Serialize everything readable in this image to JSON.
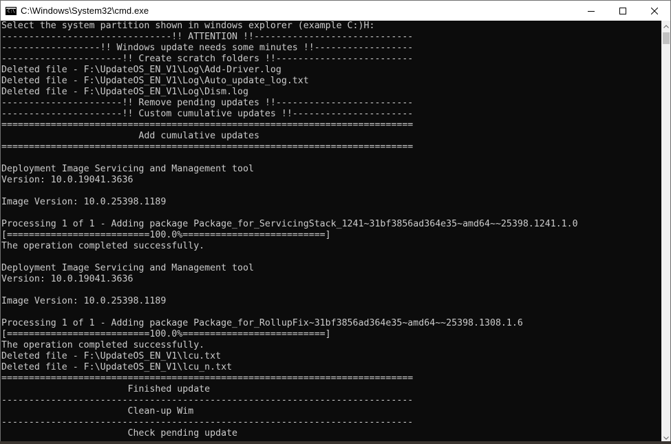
{
  "window": {
    "title": "C:\\Windows\\System32\\cmd.exe",
    "app_icon_glyph": "C:\\"
  },
  "controls": {
    "minimize_icon": "minimize-icon",
    "maximize_icon": "maximize-icon",
    "close_icon": "close-icon"
  },
  "colors": {
    "console_background": "#0c0c0c",
    "console_text": "#cccccc",
    "titlebar_background": "#ffffff",
    "scrollbar_track": "#f0f0f0",
    "scrollbar_thumb": "#c1c1c1"
  },
  "console": {
    "lines": [
      "Select the system partition shown in windows explorer (example C:)H:",
      "-------------------------------!! ATTENTION !!-----------------------------",
      "------------------!! Windows update needs some minutes !!------------------",
      "----------------------!! Create scratch folders !!-------------------------",
      "Deleted file - F:\\UpdateOS_EN_V1\\Log\\Add-Driver.log",
      "Deleted file - F:\\UpdateOS_EN_V1\\Log\\Auto_update_log.txt",
      "Deleted file - F:\\UpdateOS_EN_V1\\Log\\Dism.log",
      "----------------------!! Remove pending updates !!-------------------------",
      "----------------------!! Custom cumulative updates !!----------------------",
      "===========================================================================",
      "                         Add cumulative updates",
      "===========================================================================",
      "",
      "Deployment Image Servicing and Management tool",
      "Version: 10.0.19041.3636",
      "",
      "Image Version: 10.0.25398.1189",
      "",
      "Processing 1 of 1 - Adding package Package_for_ServicingStack_1241~31bf3856ad364e35~amd64~~25398.1241.1.0",
      "[==========================100.0%==========================]",
      "The operation completed successfully.",
      "",
      "Deployment Image Servicing and Management tool",
      "Version: 10.0.19041.3636",
      "",
      "Image Version: 10.0.25398.1189",
      "",
      "Processing 1 of 1 - Adding package Package_for_RollupFix~31bf3856ad364e35~amd64~~25398.1308.1.6",
      "[==========================100.0%==========================]",
      "The operation completed successfully.",
      "Deleted file - F:\\UpdateOS_EN_V1\\lcu.txt",
      "Deleted file - F:\\UpdateOS_EN_V1\\lcu_n.txt",
      "===========================================================================",
      "                       Finished update",
      "---------------------------------------------------------------------------",
      "                       Clean-up Wim",
      "---------------------------------------------------------------------------",
      "                       Check pending update"
    ]
  }
}
